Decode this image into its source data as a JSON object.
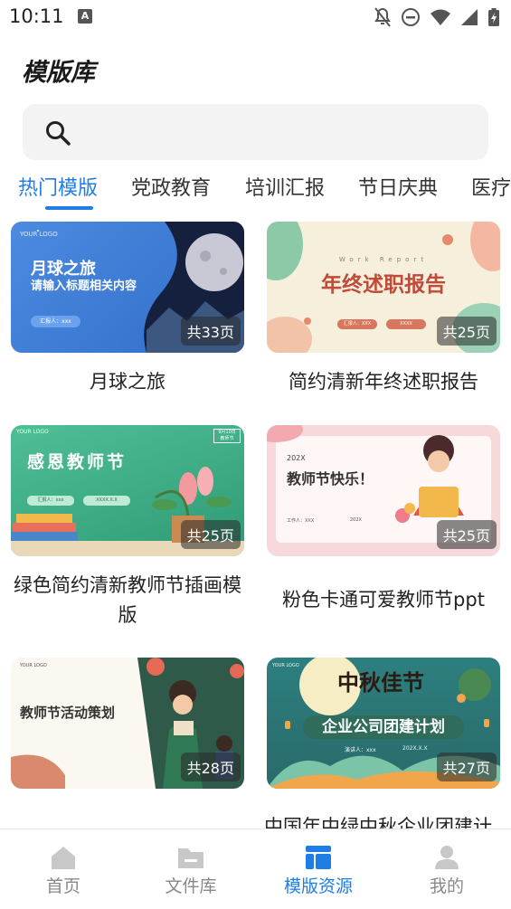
{
  "status_bar": {
    "time": "10:11",
    "icons": [
      "notification-a-icon",
      "notifications-off-icon",
      "do-not-disturb-icon",
      "wifi-icon",
      "signal-icon",
      "battery-charging-icon"
    ]
  },
  "page": {
    "title": "模版库"
  },
  "search": {
    "placeholder": ""
  },
  "tabs": [
    {
      "label": "热门模版",
      "active": true
    },
    {
      "label": "党政教育"
    },
    {
      "label": "培训汇报"
    },
    {
      "label": "节日庆典"
    },
    {
      "label": "医疗"
    }
  ],
  "templates": [
    {
      "title": "月球之旅",
      "pages": "共33页",
      "thumb": {
        "heading": "月球之旅",
        "sub": "请输入标题相关内容",
        "logo": "YOUR LOGO",
        "btn": "汇报人：xxx"
      }
    },
    {
      "title": "简约清新年终述职报告",
      "pages": "共25页",
      "thumb": {
        "heading": "年终述职报告",
        "sub": "Work Report",
        "btn1": "汇报人：XXX",
        "btn2": "XXXX"
      }
    },
    {
      "title": "绿色简约清新教师节插画模版",
      "pages": "共25页",
      "thumb": {
        "heading": "感恩教师节",
        "logo": "YOUR LOGO",
        "tag": "9月10日",
        "tag2": "教师节",
        "btn1": "汇报人：xxx",
        "btn2": "XXXX.X.X"
      }
    },
    {
      "title": "粉色卡通可爱教师节ppt",
      "pages": "共25页",
      "thumb": {
        "heading": "教师节快乐！",
        "year": "202X",
        "meta": "工作人：XXX",
        "date": "202X"
      }
    },
    {
      "title": "",
      "pages": "共28页",
      "thumb": {
        "heading": "教师节活动策划",
        "logo": "YOUR LOGO"
      }
    },
    {
      "title": "",
      "pages": "共27页",
      "thumb": {
        "heading": "中秋佳节",
        "sub": "企业公司团建计划",
        "logo": "YOUR LOGO",
        "meta": "演讲人：xxx",
        "date": "202X.X.X"
      }
    }
  ],
  "partial_title": "中国年中绿中秋企业团建计",
  "bottom_nav": [
    {
      "label": "首页",
      "icon": "home-icon"
    },
    {
      "label": "文件库",
      "icon": "folder-icon"
    },
    {
      "label": "模版资源",
      "icon": "template-icon",
      "active": true
    },
    {
      "label": "我的",
      "icon": "profile-icon"
    }
  ],
  "colors": {
    "accent": "#1e7ee6",
    "inactive": "#888888"
  }
}
